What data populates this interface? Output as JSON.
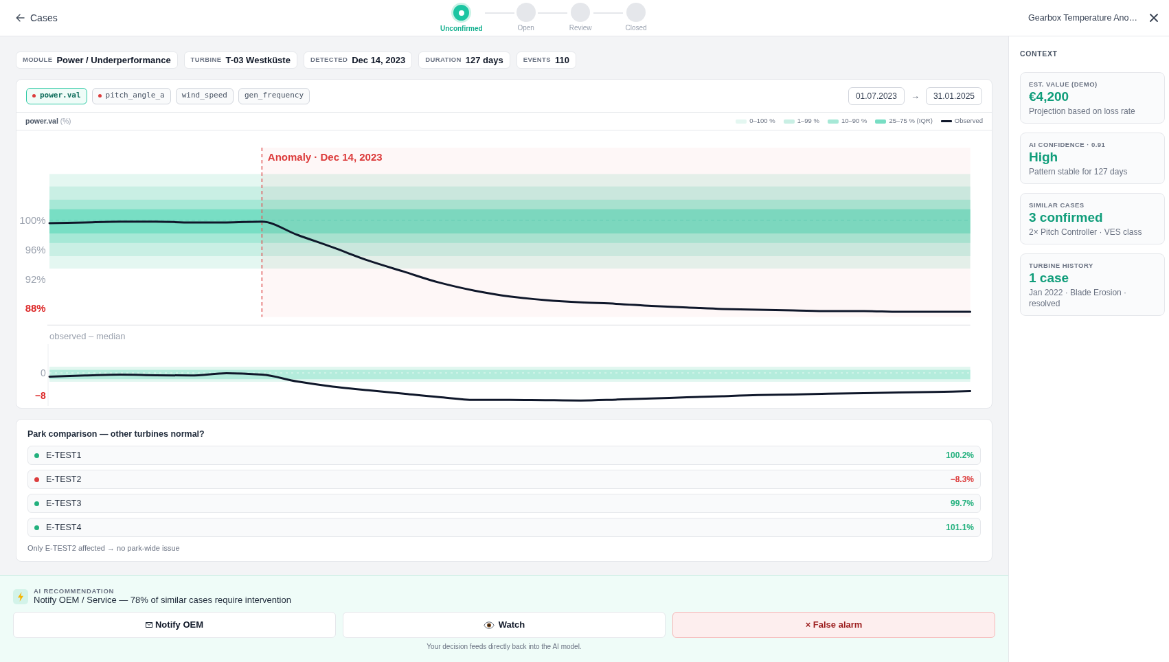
{
  "header": {
    "back": "Cases",
    "steps": [
      {
        "label": "Unconfirmed",
        "selected": true
      },
      {
        "label": "Open",
        "selected": false
      },
      {
        "label": "Review",
        "selected": false
      },
      {
        "label": "Closed",
        "selected": false
      }
    ],
    "title": "Gearbox Temperature Ano…"
  },
  "facts": [
    {
      "label": "MODULE",
      "value": "Power / Underperformance"
    },
    {
      "label": "TURBINE",
      "value": "T-03 Westküste"
    },
    {
      "label": "DETECTED",
      "value": "Dec 14, 2023"
    },
    {
      "label": "DURATION",
      "value": "127 days"
    },
    {
      "label": "EVENTS",
      "value": "110"
    }
  ],
  "signal_panel": {
    "tags": [
      {
        "label": "power.val",
        "selected": true,
        "alert": true
      },
      {
        "label": "pitch_angle_a",
        "selected": false,
        "alert": true
      },
      {
        "label": "wind_speed",
        "selected": false,
        "alert": false
      },
      {
        "label": "gen_frequency",
        "selected": false,
        "alert": false
      }
    ],
    "date_from": "01.07.2023",
    "date_separator": "→",
    "date_to": "31.01.2025",
    "metric": "power.val",
    "unit": "(%)",
    "chart_data": {
      "type": "line",
      "legend": "top-right",
      "categories": [
        null,
        null,
        null,
        null,
        null,
        null,
        null,
        null,
        null,
        null,
        null,
        null,
        null,
        null,
        null,
        null,
        null,
        null,
        null,
        null,
        null,
        null,
        null,
        null,
        null,
        null,
        null
      ],
      "ylim": [
        86.8,
        109.9
      ],
      "yticks": [
        {
          "value": 100,
          "label": "100%"
        },
        {
          "value": 96,
          "label": "96%"
        },
        {
          "value": 92,
          "label": "92%"
        },
        {
          "value": 88,
          "label": "88%"
        }
      ],
      "series": [
        {
          "name": "Observed",
          "color": "#0f172a",
          "values": [
            99.6,
            99.7,
            99.8,
            99.8,
            99.7,
            99.7,
            99.8,
            98.0,
            96.3,
            94.5,
            93.0,
            91.5,
            90.4,
            89.6,
            89.1,
            88.8,
            88.6,
            88.3,
            88.1,
            87.9,
            87.8,
            87.7,
            87.6,
            87.6,
            87.5,
            87.5,
            87.5
          ]
        }
      ],
      "bands": [
        {
          "axis": "y",
          "label": "0–100 %",
          "color": "#e4f7f1",
          "from": 93.4,
          "to": 106.3
        },
        {
          "axis": "y",
          "label": "1–99 %",
          "color": "#c9efe4",
          "from": 95.1,
          "to": 104.6
        },
        {
          "axis": "y",
          "label": "10–90 %",
          "color": "#a6e8d6",
          "from": 96.9,
          "to": 102.8
        },
        {
          "axis": "y",
          "label": "25–75 % (IQR)",
          "color": "#78dec4",
          "from": 98.2,
          "to": 101.5
        }
      ],
      "ref_lines": [
        {
          "axis": "y",
          "value": 100
        }
      ],
      "annotations": [
        "Anomaly · Dec 14, 2023"
      ]
    },
    "deviation": {
      "chart_data": {
        "type": "line",
        "title": "observed – median",
        "categories": [
          null,
          null,
          null,
          null,
          null,
          null,
          null,
          null,
          null,
          null,
          null,
          null,
          null,
          null,
          null,
          null,
          null,
          null,
          null,
          null,
          null,
          null,
          null,
          null,
          null,
          null,
          null
        ],
        "ylim": [
          -11.6,
          10.2
        ],
        "yticks": [
          {
            "value": 0,
            "label": "0"
          },
          {
            "value": -8,
            "label": "−8"
          }
        ],
        "series": [
          {
            "color": "#0f172a",
            "values": [
              -1.3,
              -0.9,
              -0.6,
              -0.8,
              -0.9,
              -0.1,
              -0.6,
              -3.0,
              -4.8,
              -6.1,
              -7.3,
              -8.5,
              -9.5,
              -9.5,
              -9.6,
              -9.7,
              -9.4,
              -9.0,
              -8.6,
              -8.2,
              -7.8,
              -7.6,
              -7.3,
              -7.1,
              -6.9,
              -6.7,
              -6.4
            ]
          }
        ],
        "bands": [
          {
            "axis": "y",
            "color": "#e2f7f0",
            "from": -3.1,
            "to": 2.2
          },
          {
            "axis": "y",
            "color": "#b4ecdc",
            "from": -2.2,
            "to": 1.1
          }
        ],
        "ref_lines": [
          {
            "axis": "y",
            "value": 0
          }
        ]
      }
    }
  },
  "park_comparison": {
    "title": "Park comparison — other turbines normal?",
    "turbines": [
      {
        "name": "E-TEST1",
        "value": "100.2%",
        "color": "#22b07d"
      },
      {
        "name": "E-TEST2",
        "value": "−8.3%",
        "color": "#dc3c3c"
      },
      {
        "name": "E-TEST3",
        "value": "99.7%",
        "color": "#22b07d"
      },
      {
        "name": "E-TEST4",
        "value": "101.1%",
        "color": "#22b07d"
      }
    ],
    "note": "Only E-TEST2 affected → no park-wide issue"
  },
  "recommendation": {
    "label": "AI RECOMMENDATION",
    "text": "Notify OEM / Service — 78% of similar cases require intervention",
    "actions": [
      {
        "label": "Notify OEM",
        "kind": "notify"
      },
      {
        "label": "Watch",
        "kind": "watch"
      },
      {
        "label": "× False alarm",
        "kind": "dismiss"
      }
    ],
    "caption": "Your decision feeds directly back into the AI model."
  },
  "context": {
    "title": "CONTEXT",
    "cards": [
      {
        "label": "EST. VALUE (DEMO)",
        "value": "€4,200",
        "detail": "Projection based on loss rate"
      },
      {
        "label": "AI CONFIDENCE · 0.91",
        "value": "High",
        "detail": "Pattern stable for 127 days"
      },
      {
        "label": "SIMILAR CASES",
        "value": "3 confirmed",
        "detail": "2× Pitch Controller · VES class"
      },
      {
        "label": "TURBINE HISTORY",
        "value": "1 case",
        "detail": "Jan 2022 · Blade Erosion · resolved"
      }
    ]
  }
}
